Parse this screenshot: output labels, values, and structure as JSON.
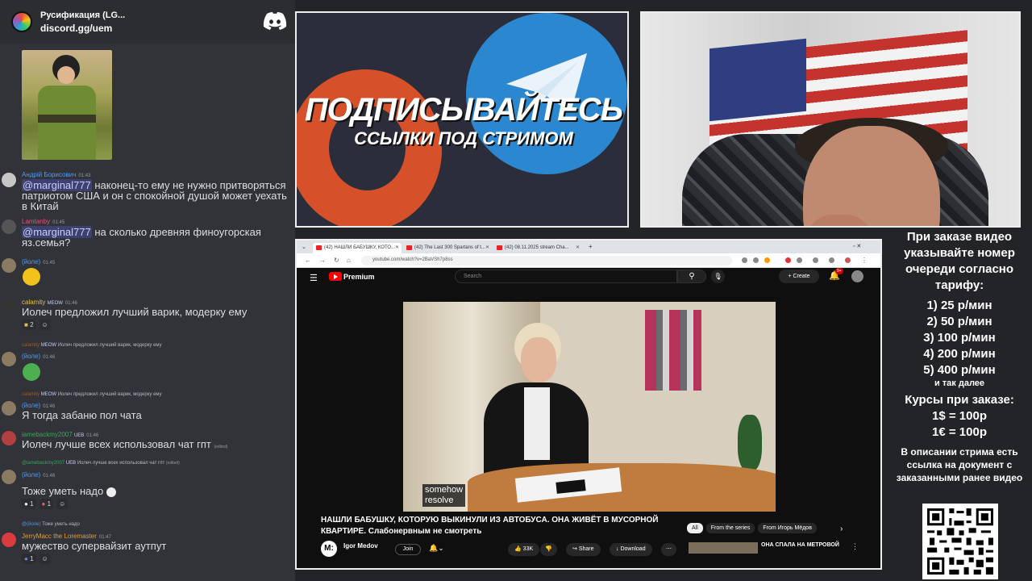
{
  "header": {
    "server_name": "Русификация (LG...",
    "invite": "discord.gg/uem"
  },
  "messages": [
    {
      "user": "Андрій Борисович",
      "time": "01:43",
      "user_color": "#4f9cf3",
      "mention": "@marginal777",
      "text": " наконец-то ему не нужно притворяться патриотом США и он с спокойной душой может уехать в Китай"
    },
    {
      "user": "Lamtanby",
      "time": "01:45",
      "user_color": "#e9507b",
      "mention": "@marginal777",
      "text": " на сколько древняя финоугорская яз.семья?"
    },
    {
      "user": "(йоле)",
      "time": "01:45",
      "user_color": "#4f9cf3"
    },
    {
      "user": "calamity",
      "badge": "MEOW",
      "time": "01:46",
      "user_color": "#e0c04a",
      "text": "Иолеч предложил лучший варик, модерку ему",
      "reactions": [
        "2"
      ]
    },
    {
      "reply_user": "calamity",
      "reply_badge": "MEOW",
      "reply_text": "Иолеч предложил лучший варик, модерку ему",
      "user": "(йоле)",
      "time": "01:46",
      "user_color": "#4f9cf3"
    },
    {
      "reply_user": "calamity",
      "reply_badge": "MEOW",
      "reply_text": "Иолеч предложил лучший варик, модерку ему",
      "user": "(йоле)",
      "time": "01:46",
      "user_color": "#4f9cf3",
      "text": "Я тогда забаню пол чата"
    },
    {
      "user": "iamebackmy2007",
      "badge": "UEB",
      "time": "01:46",
      "user_color": "#3ba55d",
      "text": "Иолеч лучше всех использовал чат гпт",
      "edited": "(edited)"
    },
    {
      "reply_user": "@iamebackmy2007",
      "reply_badge": "UEB",
      "reply_text": "Иолеч лучше всех использовал чат гпт",
      "reply_edited": "(edited)",
      "user": "(йоле)",
      "time": "01:46",
      "user_color": "#4f9cf3",
      "text": "Тоже уметь надо",
      "reactions": [
        "1",
        "1"
      ]
    },
    {
      "reply_user": "@(йоле)",
      "reply_text": "Тоже уметь надо",
      "user": "JerryMacc the Loremaster",
      "time": "01:47",
      "user_color": "#e0a040",
      "text": "мужество супервайзит аутпут",
      "reactions": [
        "1"
      ]
    }
  ],
  "promo": {
    "headline": "ПОДПИСЫВАЙТЕСЬ",
    "subline": "ССЫЛКИ ПОД СТРИМОМ"
  },
  "browser": {
    "tabs": [
      "(42) НАШЛИ БАБУШКУ, КОТО...",
      "(42) The Last 300 Spartans of t...",
      "(42) 08.11.2025 stream Cha..."
    ],
    "url": "youtube.com/watch?v=2BaVSh7p8ss"
  },
  "youtube": {
    "brand": "Premium",
    "search_placeholder": "Search",
    "create_label": "Create",
    "notif_count": "9+",
    "captions": [
      "somehow",
      "resolve"
    ],
    "title": "НАШЛИ БАБУШКУ, КОТОРУЮ ВЫКИНУЛИ ИЗ АВТОБУСА. ОНА ЖИВЁТ В МУСОРНОЙ КВАРТИРЕ. Слабонервным не смотреть",
    "chips": [
      "All",
      "From the series",
      "From Игорь Мёдов"
    ],
    "channel_initial": "M:",
    "channel_name": "Igor Medov",
    "join_label": "Join",
    "likes": "33K",
    "share_label": "Share",
    "download_label": "Download",
    "related_title": "ОНА СПАЛА НА МЕТРОВОЙ"
  },
  "rules": {
    "intro": "При заказе видео указывайте номер очереди согласно тарифу:",
    "tariffs": [
      "1) 25 р/мин",
      "2) 50 р/мин",
      "3) 100 р/мин",
      "4) 200 р/мин",
      "5) 400 р/мин"
    ],
    "etc": "и так далее",
    "courses_title": "Курсы при заказе:",
    "courses": [
      "1$ = 100р",
      "1€ = 100р"
    ],
    "description": "В описании стрима есть ссылка на документ с заказанными ранее видео"
  }
}
